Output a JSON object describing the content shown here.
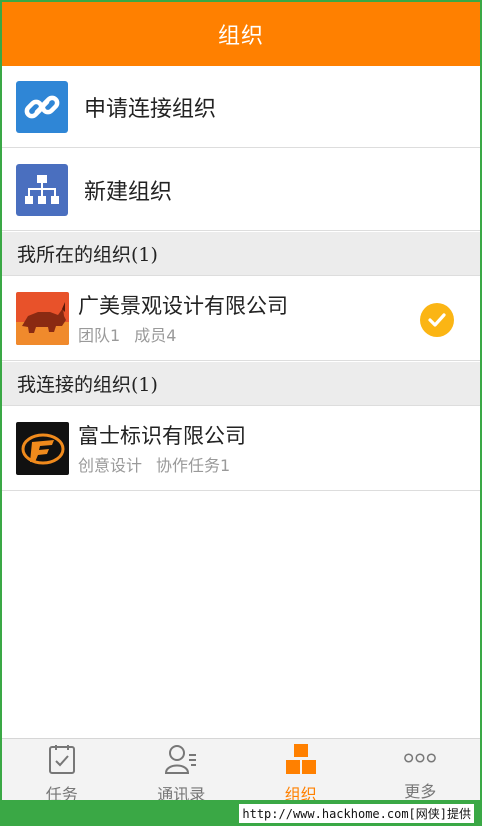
{
  "header": {
    "title": "组织"
  },
  "actions": [
    {
      "label": "申请连接组织",
      "icon": "link-icon",
      "color": "#2f86d6"
    },
    {
      "label": "新建组织",
      "icon": "org-chart-icon",
      "color": "#4a6fbf"
    }
  ],
  "my_orgs": {
    "section_title": "我所在的组织(1)",
    "items": [
      {
        "name": "广美景观设计有限公司",
        "meta1": "团队1",
        "meta2": "成员4",
        "selected": true
      }
    ]
  },
  "connected_orgs": {
    "section_title": "我连接的组织(1)",
    "items": [
      {
        "name": "富士标识有限公司",
        "meta1": "创意设计",
        "meta2": "协作任务1"
      }
    ]
  },
  "tabs": [
    {
      "label": "任务",
      "icon": "task-icon",
      "active": false
    },
    {
      "label": "通讯录",
      "icon": "contacts-icon",
      "active": false
    },
    {
      "label": "组织",
      "icon": "organization-icon",
      "active": true
    },
    {
      "label": "更多",
      "icon": "more-icon",
      "active": false
    }
  ],
  "watermark": "http://www.hackhome.com[网侠]提供",
  "colors": {
    "accent": "#ff8000",
    "check": "#fbb514",
    "frame": "#3aa845"
  }
}
